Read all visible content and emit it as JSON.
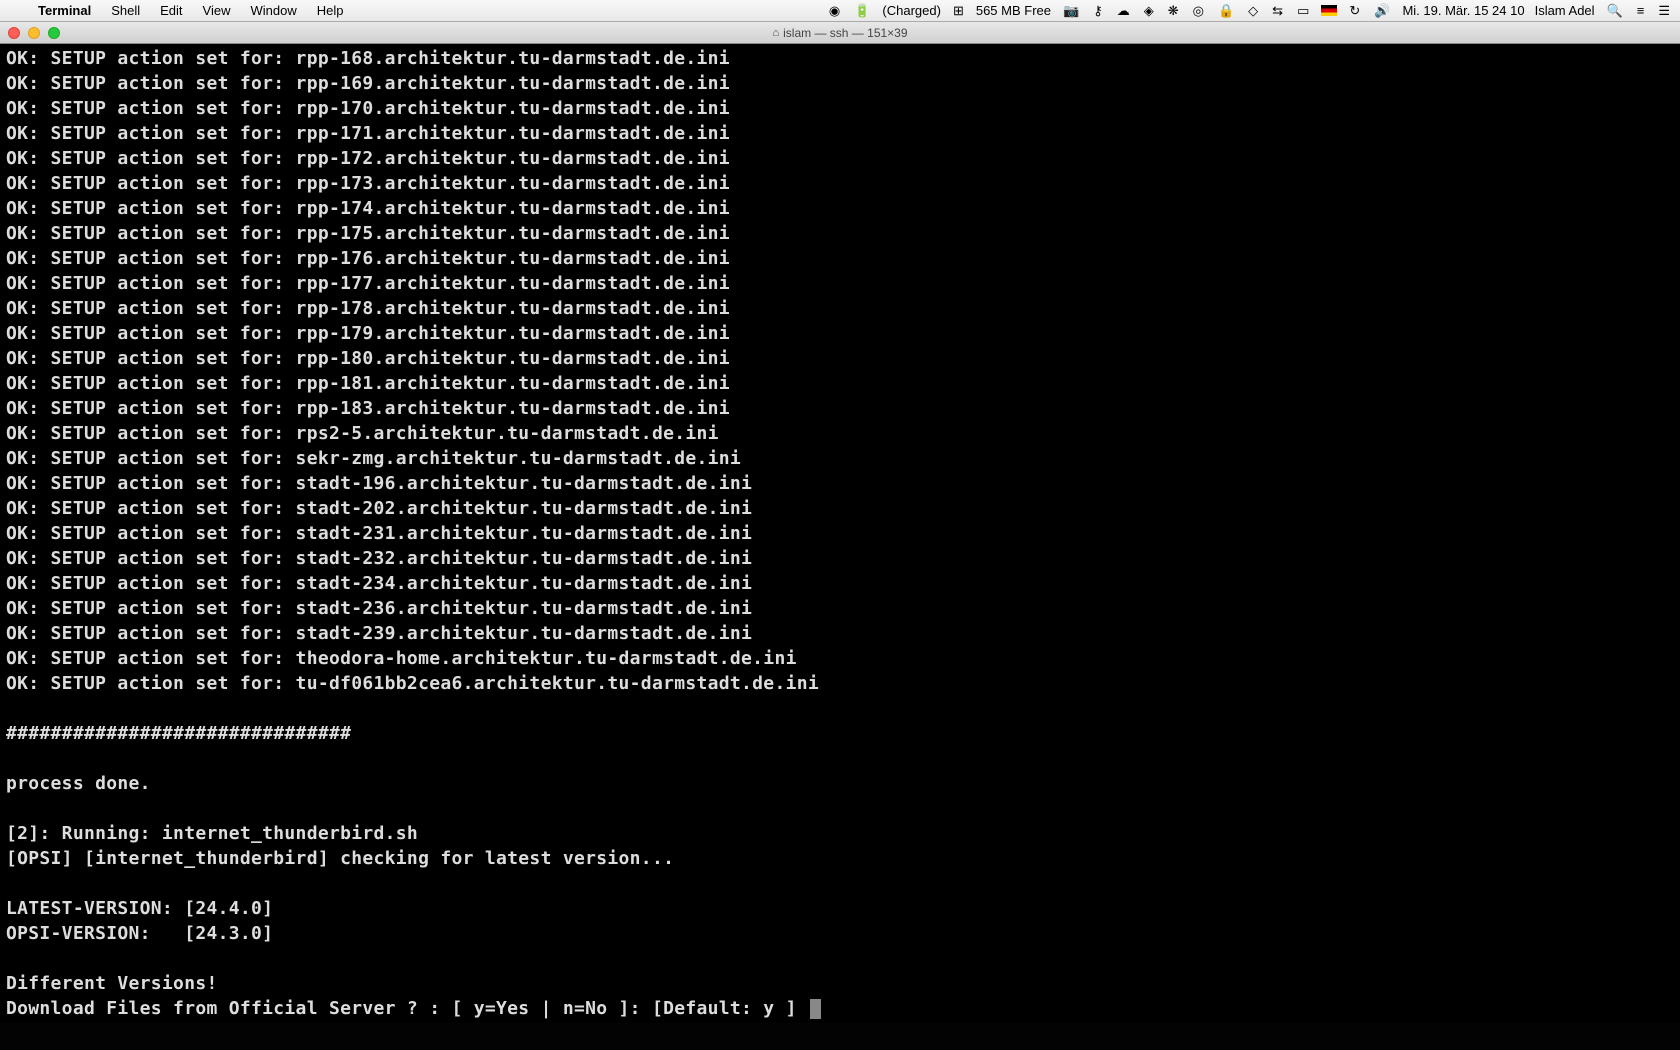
{
  "menubar": {
    "app_name": "Terminal",
    "menus": [
      "Shell",
      "Edit",
      "View",
      "Window",
      "Help"
    ],
    "battery": "(Charged)",
    "mem_free": "565 MB Free",
    "datetime": "Mi. 19. Mär.  15 24 10",
    "username": "Islam Adel"
  },
  "window": {
    "title": "islam — ssh — 151×39"
  },
  "terminal": {
    "lines": [
      "OK: SETUP action set for: rpp-168.architektur.tu-darmstadt.de.ini",
      "OK: SETUP action set for: rpp-169.architektur.tu-darmstadt.de.ini",
      "OK: SETUP action set for: rpp-170.architektur.tu-darmstadt.de.ini",
      "OK: SETUP action set for: rpp-171.architektur.tu-darmstadt.de.ini",
      "OK: SETUP action set for: rpp-172.architektur.tu-darmstadt.de.ini",
      "OK: SETUP action set for: rpp-173.architektur.tu-darmstadt.de.ini",
      "OK: SETUP action set for: rpp-174.architektur.tu-darmstadt.de.ini",
      "OK: SETUP action set for: rpp-175.architektur.tu-darmstadt.de.ini",
      "OK: SETUP action set for: rpp-176.architektur.tu-darmstadt.de.ini",
      "OK: SETUP action set for: rpp-177.architektur.tu-darmstadt.de.ini",
      "OK: SETUP action set for: rpp-178.architektur.tu-darmstadt.de.ini",
      "OK: SETUP action set for: rpp-179.architektur.tu-darmstadt.de.ini",
      "OK: SETUP action set for: rpp-180.architektur.tu-darmstadt.de.ini",
      "OK: SETUP action set for: rpp-181.architektur.tu-darmstadt.de.ini",
      "OK: SETUP action set for: rpp-183.architektur.tu-darmstadt.de.ini",
      "OK: SETUP action set for: rps2-5.architektur.tu-darmstadt.de.ini",
      "OK: SETUP action set for: sekr-zmg.architektur.tu-darmstadt.de.ini",
      "OK: SETUP action set for: stadt-196.architektur.tu-darmstadt.de.ini",
      "OK: SETUP action set for: stadt-202.architektur.tu-darmstadt.de.ini",
      "OK: SETUP action set for: stadt-231.architektur.tu-darmstadt.de.ini",
      "OK: SETUP action set for: stadt-232.architektur.tu-darmstadt.de.ini",
      "OK: SETUP action set for: stadt-234.architektur.tu-darmstadt.de.ini",
      "OK: SETUP action set for: stadt-236.architektur.tu-darmstadt.de.ini",
      "OK: SETUP action set for: stadt-239.architektur.tu-darmstadt.de.ini",
      "OK: SETUP action set for: theodora-home.architektur.tu-darmstadt.de.ini",
      "OK: SETUP action set for: tu-df061bb2cea6.architektur.tu-darmstadt.de.ini",
      "",
      "###############################",
      "",
      "process done.",
      "",
      "[2]: Running: internet_thunderbird.sh",
      "[OPSI] [internet_thunderbird] checking for latest version...",
      "",
      "LATEST-VERSION: [24.4.0]",
      "OPSI-VERSION:   [24.3.0]",
      "",
      "Different Versions!"
    ],
    "prompt": "Download Files from Official Server ? : [ y=Yes | n=No ]: [Default: y ] "
  }
}
